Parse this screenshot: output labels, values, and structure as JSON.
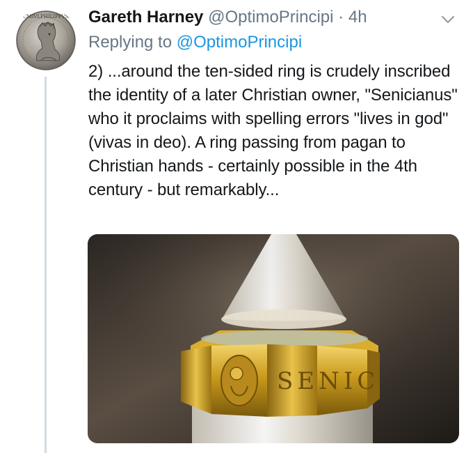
{
  "tweet": {
    "author_name": "Gareth Harney",
    "author_handle": "@OptimoPrincipi",
    "separator": "·",
    "time": "4h",
    "reply_prefix": "Replying to",
    "reply_handle": "@OptimoPrincipi",
    "text": "2) ...around the ten-sided ring is crudely inscribed the identity of a later Christian owner, \"Senicianus\" who it proclaims with spelling errors \"lives in god\" (vivas in deo). A ring passing from pagan to Christian hands - certainly possible in the 4th century - but remarkably...",
    "avatar": {
      "legend": "IMPCMIVLPHILIPPVSAVG",
      "description_icon": "roman-coin-avatar"
    },
    "media": {
      "ring_inscription": "SENIC",
      "icon": "gold-ring-photo"
    }
  },
  "colors": {
    "text_primary": "#14171a",
    "text_secondary": "#657786",
    "link": "#1b95e0",
    "thread_line": "#d3dae0"
  }
}
